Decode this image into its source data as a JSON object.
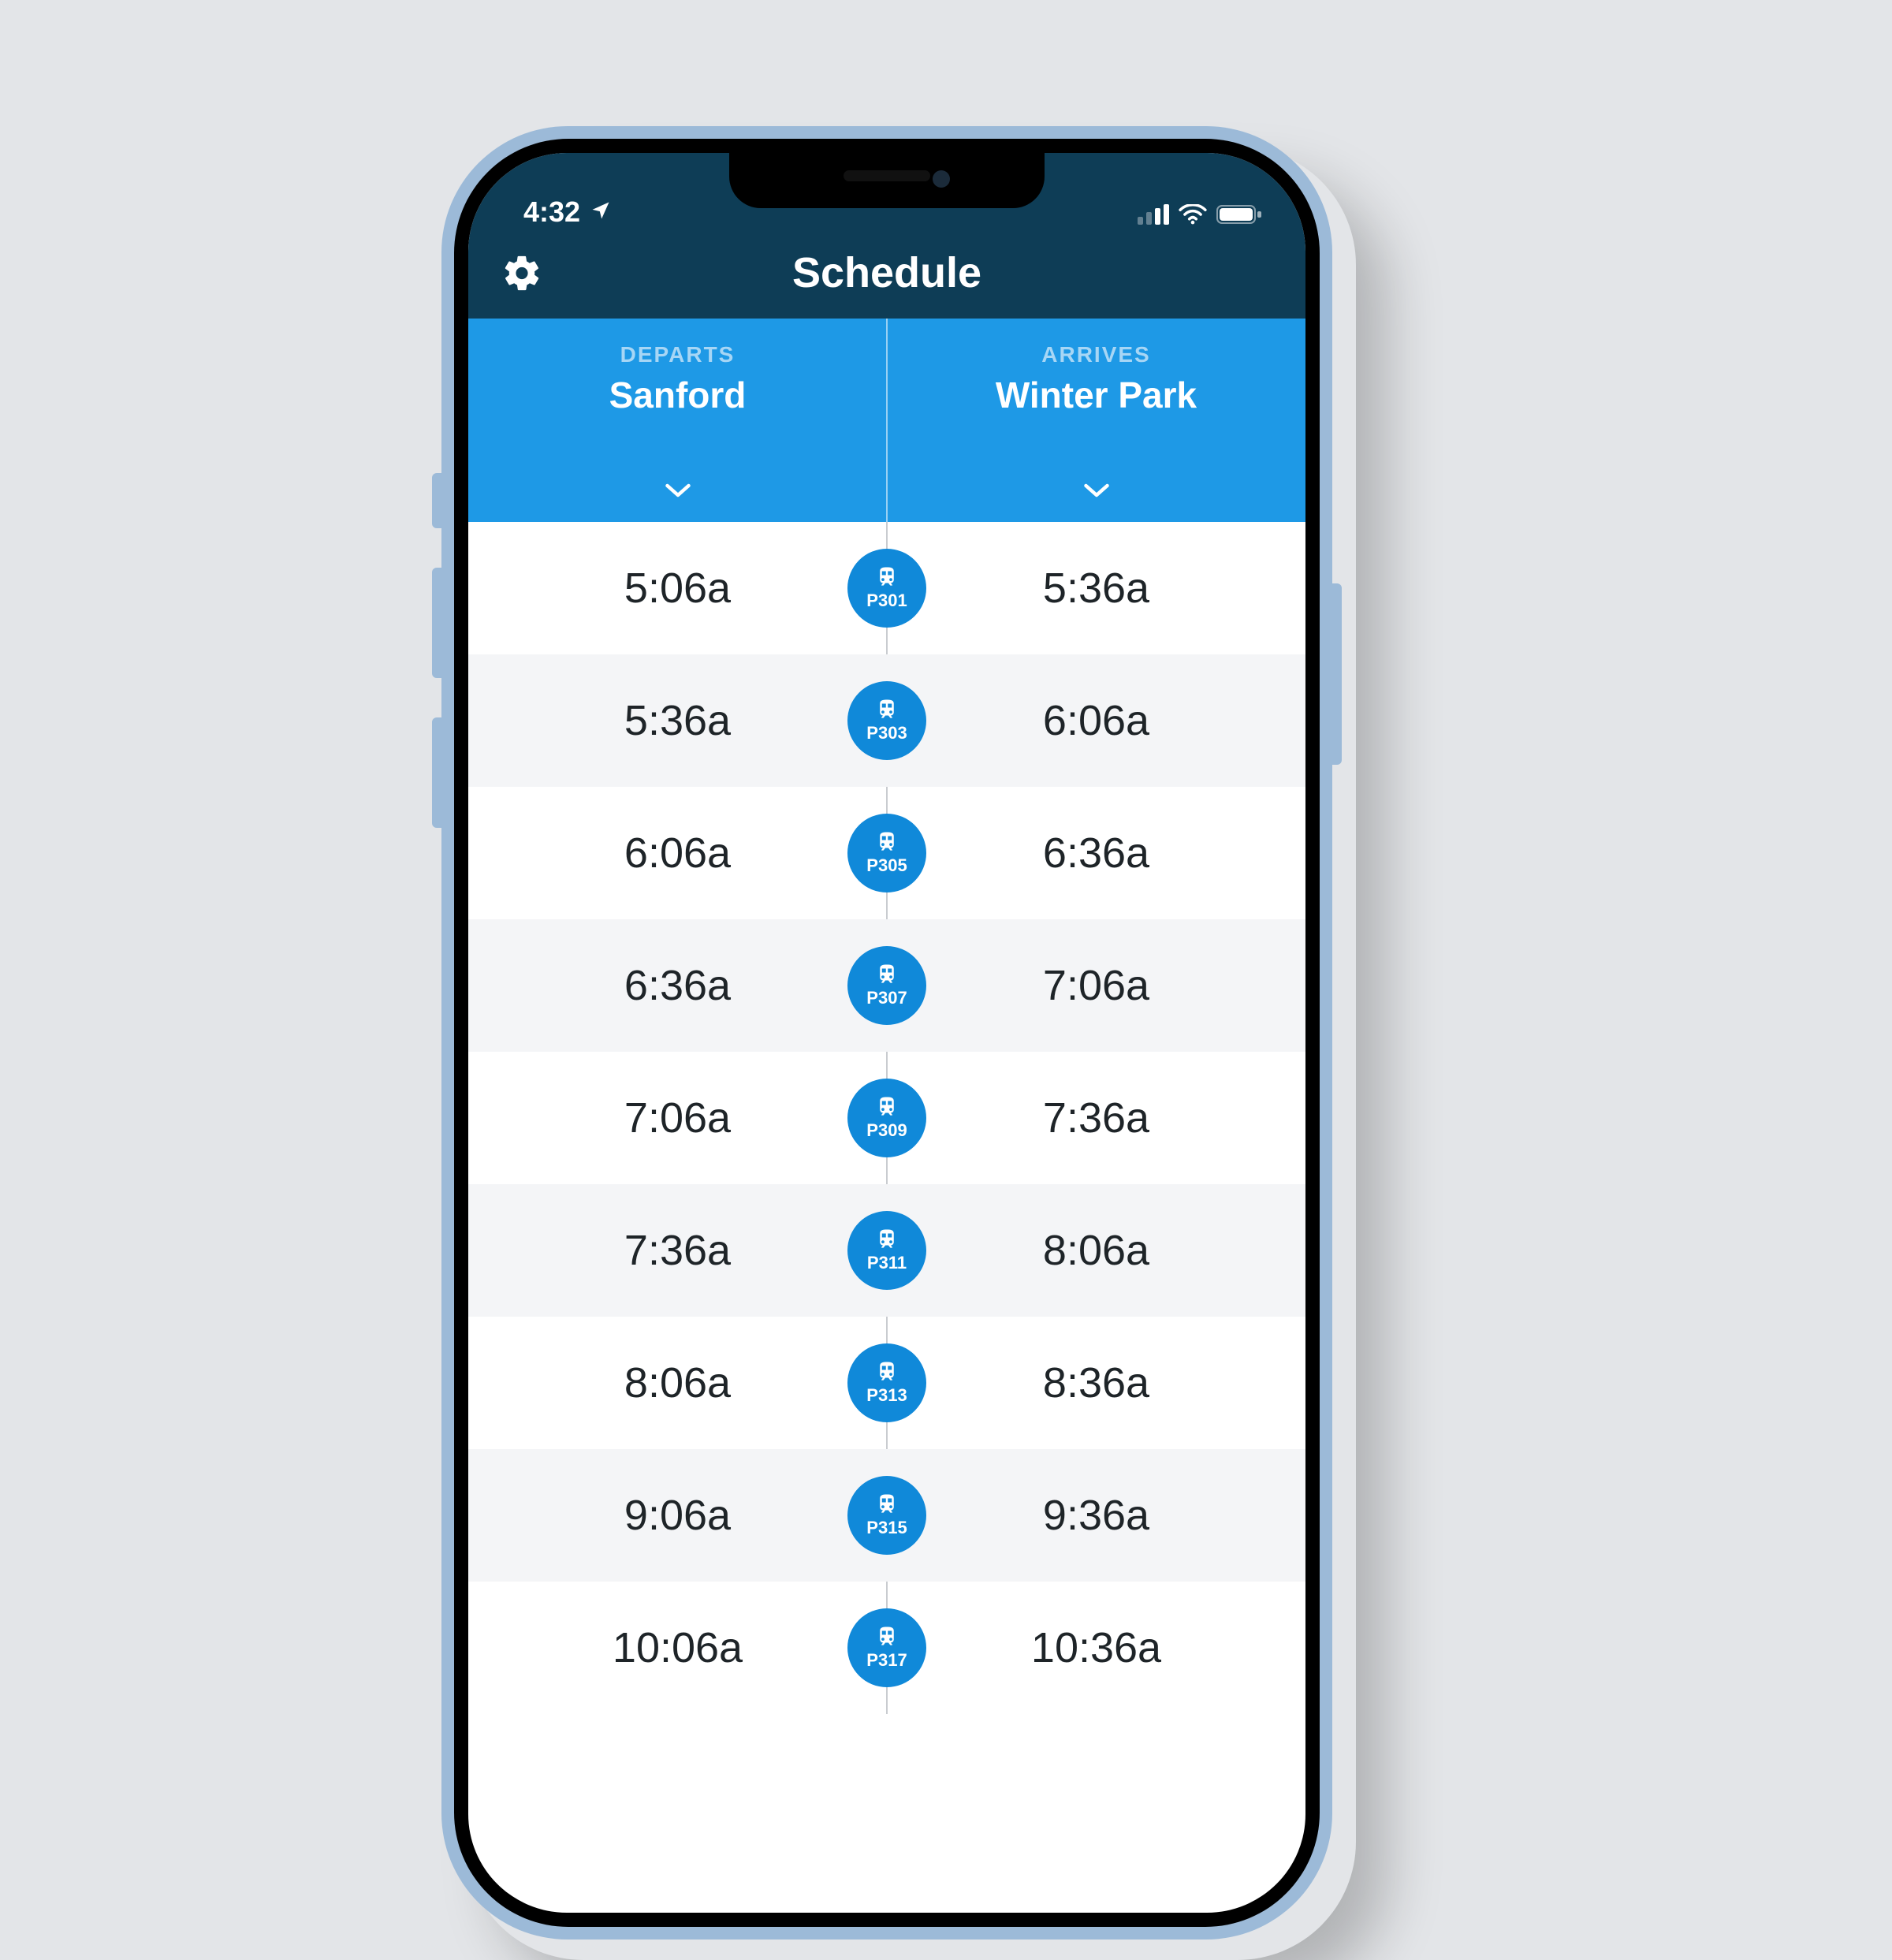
{
  "status_bar": {
    "time": "4:32",
    "icons": {
      "location": "location-arrow-icon",
      "signal": "cell-signal-icon",
      "wifi": "wifi-icon",
      "battery": "battery-icon"
    }
  },
  "header": {
    "title": "Schedule",
    "settings_icon": "gear-icon"
  },
  "route": {
    "departs_label": "DEPARTS",
    "departs_station": "Sanford",
    "arrives_label": "ARRIVES",
    "arrives_station": "Winter Park"
  },
  "colors": {
    "header_bg": "#0e3d56",
    "route_bg": "#1e99e6",
    "badge_bg": "#1089d9"
  },
  "schedule": [
    {
      "depart": "5:06a",
      "train": "P301",
      "arrive": "5:36a"
    },
    {
      "depart": "5:36a",
      "train": "P303",
      "arrive": "6:06a"
    },
    {
      "depart": "6:06a",
      "train": "P305",
      "arrive": "6:36a"
    },
    {
      "depart": "6:36a",
      "train": "P307",
      "arrive": "7:06a"
    },
    {
      "depart": "7:06a",
      "train": "P309",
      "arrive": "7:36a"
    },
    {
      "depart": "7:36a",
      "train": "P311",
      "arrive": "8:06a"
    },
    {
      "depart": "8:06a",
      "train": "P313",
      "arrive": "8:36a"
    },
    {
      "depart": "9:06a",
      "train": "P315",
      "arrive": "9:36a"
    },
    {
      "depart": "10:06a",
      "train": "P317",
      "arrive": "10:36a"
    }
  ]
}
